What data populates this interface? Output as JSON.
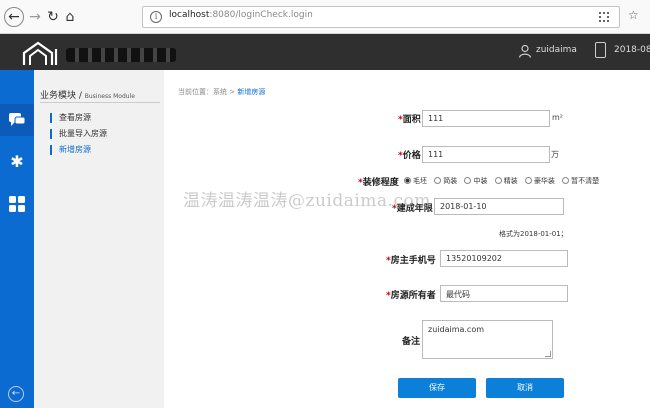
{
  "browser": {
    "back_icon": "arrow-left-icon",
    "forward_icon": "arrow-right-icon",
    "url_host": "localhost",
    "url_path": ":8080/loginCheck.login"
  },
  "header": {
    "user_name": "zuidaima",
    "date": "2018-08"
  },
  "sidebar": {
    "title": "业务模块 / ",
    "title_sub": "Business Module",
    "items": [
      {
        "label": "查看房源"
      },
      {
        "label": "批量导入房源"
      },
      {
        "label": "新增房源"
      }
    ]
  },
  "breadcrumb": {
    "prefix": "当前位置：系统 > ",
    "current": "新增房源"
  },
  "form": {
    "area_label": "面积",
    "area_value": "111",
    "area_unit": "m²",
    "price_label": "价格",
    "price_value": "111",
    "price_unit": "万",
    "decoration_label": "装修程度",
    "decoration_options": [
      "毛坯",
      "简装",
      "中装",
      "精装",
      "豪华装",
      "暂不清楚"
    ],
    "decoration_selected": "毛坯",
    "year_label": "建成年限",
    "year_value": "2018-01-10",
    "year_hint": "格式为2018-01-01；",
    "phone_label": "房主手机号",
    "phone_value": "13520109202",
    "owner_label": "房源所有者",
    "owner_value": "最代码",
    "note_label": "备注",
    "note_value": "zuidaima.com",
    "save_label": "保存",
    "cancel_label": "取消"
  },
  "watermark": "温涛温涛温涛@zuidaima.com",
  "colors": {
    "accent": "#0c6bd1",
    "header_bg": "#2f2f2f",
    "button": "#0c7fd8"
  }
}
